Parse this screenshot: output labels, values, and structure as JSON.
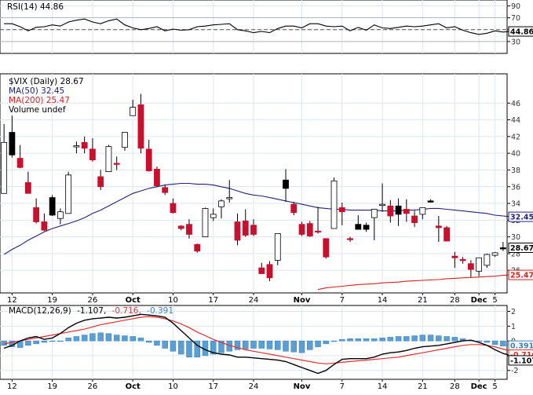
{
  "colors": {
    "up": "#ffffff",
    "down": "#c8102e",
    "doji": "#000000",
    "ma50": "#22227a",
    "ma200": "#d22222",
    "macd_hist": "#5a9fd4",
    "macd_line": "#000000",
    "signal_line": "#e03030",
    "grid": "#dde5f0",
    "axis": "#000000"
  },
  "chart_data": [
    {
      "panel": "rsi",
      "type": "line",
      "legend": "RSI(14) 44.86",
      "ylim": [
        10,
        100
      ],
      "ticks": [
        "90",
        "70",
        "50",
        "30"
      ],
      "last_value_label": "44.86",
      "reference_line": 50,
      "values": [
        60,
        60,
        55,
        48,
        54,
        55,
        58,
        56,
        63,
        66,
        68,
        63,
        60,
        65,
        68,
        58,
        53,
        50,
        52,
        55,
        48,
        51,
        49,
        50,
        55,
        56,
        58,
        59,
        60,
        50,
        48,
        45,
        47,
        45,
        52,
        56,
        56,
        53,
        60,
        60,
        56,
        55,
        56,
        48,
        54,
        49,
        58,
        53,
        52,
        54,
        56,
        55,
        56,
        58,
        60,
        53,
        55,
        49,
        45,
        42,
        44,
        48,
        46,
        47
      ]
    },
    {
      "panel": "price",
      "type": "candlestick",
      "legend": [
        "$VIX (Daily) 28.67",
        "MA(50) 32.45",
        "MA(200) 25.47",
        "Volume undef"
      ],
      "ylim": [
        23.3,
        49.5
      ],
      "ticks": [
        "46",
        "44",
        "42",
        "40",
        "38",
        "36",
        "34",
        "32",
        "30",
        "28",
        "26"
      ],
      "last_value_labels": [
        "32.45",
        "28.67",
        "25.47"
      ],
      "candles": [
        {
          "o": 35.2,
          "h": 43.5,
          "l": 35.2,
          "c": 41.3,
          "k": "up"
        },
        {
          "o": 42.5,
          "h": 44.5,
          "l": 39.5,
          "c": 39.8,
          "k": "doji"
        },
        {
          "o": 39.4,
          "h": 41.0,
          "l": 38.2,
          "c": 38.3,
          "k": "down"
        },
        {
          "o": 36.5,
          "h": 37.8,
          "l": 35.2,
          "c": 35.2,
          "k": "down"
        },
        {
          "o": 33.5,
          "h": 34.6,
          "l": 31.6,
          "c": 31.8,
          "k": "down"
        },
        {
          "o": 31.8,
          "h": 32.8,
          "l": 30.7,
          "c": 30.8,
          "k": "down"
        },
        {
          "o": 34.7,
          "h": 35.0,
          "l": 32.5,
          "c": 32.6,
          "k": "doji"
        },
        {
          "o": 32.2,
          "h": 33.4,
          "l": 31.5,
          "c": 33.0,
          "k": "up"
        },
        {
          "o": 32.8,
          "h": 37.8,
          "l": 32.8,
          "c": 37.4,
          "k": "up"
        },
        {
          "o": 40.9,
          "h": 41.4,
          "l": 40.0,
          "c": 40.8,
          "k": "up"
        },
        {
          "o": 41.3,
          "h": 42.0,
          "l": 40.0,
          "c": 40.6,
          "k": "down"
        },
        {
          "o": 40.5,
          "h": 41.8,
          "l": 39.0,
          "c": 39.2,
          "k": "down"
        },
        {
          "o": 37.2,
          "h": 38.0,
          "l": 35.6,
          "c": 36.0,
          "k": "down"
        },
        {
          "o": 37.8,
          "h": 41.0,
          "l": 37.8,
          "c": 40.8,
          "k": "up"
        },
        {
          "o": 38.8,
          "h": 39.6,
          "l": 38.0,
          "c": 38.7,
          "k": "down"
        },
        {
          "o": 40.7,
          "h": 42.5,
          "l": 40.3,
          "c": 42.5,
          "k": "up"
        },
        {
          "o": 44.5,
          "h": 46.4,
          "l": 44.5,
          "c": 45.5,
          "k": "up"
        },
        {
          "o": 45.8,
          "h": 47.1,
          "l": 40.0,
          "c": 40.6,
          "k": "down"
        },
        {
          "o": 40.5,
          "h": 41.6,
          "l": 37.8,
          "c": 37.9,
          "k": "down"
        },
        {
          "o": 38.1,
          "h": 38.4,
          "l": 36.0,
          "c": 36.1,
          "k": "down"
        },
        {
          "o": 35.9,
          "h": 36.2,
          "l": 35.0,
          "c": 35.3,
          "k": "down"
        },
        {
          "o": 34.0,
          "h": 34.6,
          "l": 32.8,
          "c": 32.9,
          "k": "down"
        },
        {
          "o": 31.3,
          "h": 31.4,
          "l": 30.8,
          "c": 31.0,
          "k": "down"
        },
        {
          "o": 31.5,
          "h": 32.1,
          "l": 29.8,
          "c": 30.3,
          "k": "down"
        },
        {
          "o": 29.1,
          "h": 29.2,
          "l": 28.1,
          "c": 28.3,
          "k": "down"
        },
        {
          "o": 30.0,
          "h": 33.5,
          "l": 30.0,
          "c": 33.4,
          "k": "up"
        },
        {
          "o": 32.3,
          "h": 33.4,
          "l": 31.9,
          "c": 32.7,
          "k": "up"
        },
        {
          "o": 33.6,
          "h": 34.5,
          "l": 32.2,
          "c": 34.3,
          "k": "up"
        },
        {
          "o": 34.6,
          "h": 36.8,
          "l": 34.1,
          "c": 34.7,
          "k": "up"
        },
        {
          "o": 31.8,
          "h": 32.8,
          "l": 29.0,
          "c": 29.6,
          "k": "down"
        },
        {
          "o": 31.9,
          "h": 33.3,
          "l": 30.0,
          "c": 30.2,
          "k": "down"
        },
        {
          "o": 31.4,
          "h": 32.1,
          "l": 30.1,
          "c": 30.3,
          "k": "down"
        },
        {
          "o": 26.3,
          "h": 26.9,
          "l": 26.2,
          "c": 25.6,
          "k": "down"
        },
        {
          "o": 26.7,
          "h": 27.1,
          "l": 24.7,
          "c": 25.1,
          "k": "down"
        },
        {
          "o": 27.2,
          "h": 30.4,
          "l": 26.6,
          "c": 30.4,
          "k": "up"
        },
        {
          "o": 36.8,
          "h": 38.1,
          "l": 34.2,
          "c": 35.8,
          "k": "doji"
        },
        {
          "o": 33.9,
          "h": 34.2,
          "l": 32.6,
          "c": 32.9,
          "k": "down"
        },
        {
          "o": 31.5,
          "h": 31.8,
          "l": 30.1,
          "c": 30.3,
          "k": "down"
        },
        {
          "o": 31.6,
          "h": 31.9,
          "l": 30.0,
          "c": 30.1,
          "k": "down"
        },
        {
          "o": 30.7,
          "h": 33.6,
          "l": 30.4,
          "c": 30.6,
          "k": "down"
        },
        {
          "o": 29.8,
          "h": 29.8,
          "l": 27.4,
          "c": 27.6,
          "k": "down"
        },
        {
          "o": 31.0,
          "h": 37.1,
          "l": 31.0,
          "c": 36.7,
          "k": "up"
        },
        {
          "o": 33.5,
          "h": 34.1,
          "l": 31.4,
          "c": 33.0,
          "k": "down"
        },
        {
          "o": 29.8,
          "h": 30.0,
          "l": 29.4,
          "c": 29.7,
          "k": "down"
        },
        {
          "o": 31.5,
          "h": 32.6,
          "l": 30.9,
          "c": 30.9,
          "k": "doji"
        },
        {
          "o": 30.9,
          "h": 31.7,
          "l": 30.6,
          "c": 31.4,
          "k": "doji"
        },
        {
          "o": 32.3,
          "h": 33.1,
          "l": 29.6,
          "c": 33.3,
          "k": "up"
        },
        {
          "o": 33.9,
          "h": 36.4,
          "l": 33.0,
          "c": 33.8,
          "k": "up"
        },
        {
          "o": 33.7,
          "h": 34.4,
          "l": 31.7,
          "c": 32.5,
          "k": "down"
        },
        {
          "o": 33.7,
          "h": 34.6,
          "l": 31.3,
          "c": 32.7,
          "k": "doji"
        },
        {
          "o": 33.3,
          "h": 34.5,
          "l": 31.8,
          "c": 32.8,
          "k": "down"
        },
        {
          "o": 32.5,
          "h": 33.1,
          "l": 31.2,
          "c": 31.7,
          "k": "down"
        },
        {
          "o": 32.7,
          "h": 33.5,
          "l": 32.1,
          "c": 33.5,
          "k": "up"
        },
        {
          "o": 34.3,
          "h": 34.5,
          "l": 34.1,
          "c": 34.3,
          "k": "doji"
        },
        {
          "o": 31.3,
          "h": 32.5,
          "l": 29.4,
          "c": 31.1,
          "k": "down"
        },
        {
          "o": 31.1,
          "h": 31.3,
          "l": 29.6,
          "c": 29.5,
          "k": "down"
        },
        {
          "o": 27.7,
          "h": 28.2,
          "l": 26.3,
          "c": 27.5,
          "k": "down"
        },
        {
          "o": 27.3,
          "h": 27.6,
          "l": 26.8,
          "c": 27.2,
          "k": "down"
        },
        {
          "o": 26.8,
          "h": 27.2,
          "l": 25.2,
          "c": 26.1,
          "k": "down"
        },
        {
          "o": 25.9,
          "h": 27.5,
          "l": 25.3,
          "c": 27.5,
          "k": "up"
        },
        {
          "o": 26.6,
          "h": 28.0,
          "l": 26.3,
          "c": 27.9,
          "k": "up"
        },
        {
          "o": 27.8,
          "h": 28.2,
          "l": 27.6,
          "c": 28.1,
          "k": "up"
        },
        {
          "o": 28.6,
          "h": 29.4,
          "l": 28.3,
          "c": 28.7,
          "k": "doji"
        }
      ],
      "ma50": [
        27.9,
        28.5,
        29.0,
        29.6,
        30.1,
        30.6,
        31.0,
        31.3,
        31.6,
        31.9,
        32.3,
        32.8,
        33.2,
        33.7,
        34.2,
        34.7,
        35.2,
        35.5,
        35.8,
        36.0,
        36.2,
        36.3,
        36.4,
        36.4,
        36.3,
        36.3,
        36.2,
        36.0,
        35.8,
        35.5,
        35.2,
        35.0,
        34.9,
        34.7,
        34.5,
        34.3,
        34.1,
        33.9,
        33.7,
        33.5,
        33.4,
        33.3,
        33.3,
        33.2,
        33.2,
        33.2,
        33.2,
        33.1,
        33.1,
        33.1,
        33.2,
        33.2,
        33.3,
        33.4,
        33.4,
        33.3,
        33.2,
        33.1,
        33.0,
        32.9,
        32.8,
        32.6,
        32.5,
        32.4
      ],
      "ma200": [
        null,
        null,
        null,
        null,
        null,
        null,
        null,
        null,
        null,
        null,
        null,
        null,
        null,
        null,
        null,
        null,
        null,
        null,
        null,
        null,
        null,
        null,
        null,
        null,
        null,
        null,
        null,
        null,
        null,
        null,
        null,
        null,
        null,
        null,
        null,
        null,
        null,
        null,
        null,
        23.7,
        23.9,
        24.0,
        24.1,
        24.2,
        24.3,
        24.35,
        24.4,
        24.5,
        24.55,
        24.6,
        24.7,
        24.75,
        24.8,
        24.85,
        24.9,
        25.0,
        25.05,
        25.1,
        25.15,
        25.2,
        25.25,
        25.3,
        25.4,
        25.45
      ]
    },
    {
      "panel": "macd",
      "type": "line",
      "legend_parts": [
        "MACD(12,26,9)",
        "-1.107,",
        "-0.716,",
        "-0.391"
      ],
      "ylim": [
        -2.6,
        2.4
      ],
      "ticks": [
        "2",
        "1",
        "0",
        "-1",
        "-2"
      ],
      "last_value_labels": [
        "0.391",
        "-0.716",
        "-1.107"
      ],
      "macd": [
        -0.5,
        -0.3,
        0.0,
        0.2,
        0.3,
        0.1,
        0.2,
        0.5,
        0.9,
        1.2,
        1.4,
        1.5,
        1.55,
        1.6,
        1.55,
        1.6,
        1.7,
        1.8,
        1.75,
        1.7,
        1.6,
        1.2,
        0.7,
        0.2,
        -0.3,
        -0.6,
        -0.8,
        -0.9,
        -0.95,
        -1.1,
        -1.1,
        -1.15,
        -1.2,
        -1.25,
        -1.3,
        -1.4,
        -1.6,
        -1.8,
        -2.0,
        -2.2,
        -2.0,
        -1.6,
        -1.25,
        -1.2,
        -1.2,
        -1.2,
        -1.1,
        -0.9,
        -0.8,
        -0.75,
        -0.65,
        -0.5,
        -0.4,
        -0.35,
        -0.3,
        -0.2,
        -0.1,
        0.0,
        0.05,
        -0.1,
        -0.3,
        -0.6,
        -0.85,
        -1.0
      ],
      "signal": [
        -0.2,
        -0.1,
        0.0,
        0.1,
        0.2,
        0.3,
        0.4,
        0.5,
        0.6,
        0.7,
        0.8,
        0.95,
        1.1,
        1.2,
        1.3,
        1.4,
        1.5,
        1.6,
        1.65,
        1.6,
        1.5,
        1.35,
        1.15,
        0.9,
        0.6,
        0.35,
        0.1,
        -0.1,
        -0.3,
        -0.45,
        -0.6,
        -0.7,
        -0.8,
        -0.9,
        -1.0,
        -1.1,
        -1.2,
        -1.3,
        -1.4,
        -1.5,
        -1.55,
        -1.5,
        -1.45,
        -1.4,
        -1.35,
        -1.3,
        -1.25,
        -1.2,
        -1.15,
        -1.1,
        -1.0,
        -0.9,
        -0.8,
        -0.7,
        -0.6,
        -0.5,
        -0.4,
        -0.3,
        -0.25,
        -0.25,
        -0.3,
        -0.4,
        -0.55,
        -0.7
      ],
      "histogram": [
        -0.3,
        -0.4,
        -0.45,
        -0.3,
        -0.2,
        -0.1,
        0.0,
        0.0,
        0.2,
        0.3,
        0.4,
        0.5,
        0.55,
        0.5,
        0.4,
        0.35,
        0.3,
        0.2,
        -0.1,
        -0.3,
        -0.5,
        -0.7,
        -0.9,
        -1.1,
        -1.1,
        -1.0,
        -0.9,
        -0.8,
        -0.7,
        -0.6,
        -0.55,
        -0.5,
        -0.5,
        -0.55,
        -0.6,
        -0.7,
        -0.75,
        -0.8,
        -0.6,
        -0.4,
        -0.2,
        0.0,
        0.1,
        0.15,
        0.15,
        0.15,
        0.15,
        0.2,
        0.25,
        0.3,
        0.3,
        0.35,
        0.4,
        0.4,
        0.35,
        0.3,
        0.25,
        0.15,
        0.05,
        -0.05,
        -0.1,
        -0.25,
        -0.35,
        -0.4
      ]
    }
  ],
  "x_axis": {
    "labels": [
      {
        "text": "12",
        "i": 1,
        "bold": false
      },
      {
        "text": "19",
        "i": 6,
        "bold": false
      },
      {
        "text": "26",
        "i": 11,
        "bold": false
      },
      {
        "text": "Oct",
        "i": 16,
        "bold": true
      },
      {
        "text": "10",
        "i": 21,
        "bold": false
      },
      {
        "text": "17",
        "i": 26,
        "bold": false
      },
      {
        "text": "24",
        "i": 31,
        "bold": false
      },
      {
        "text": "Nov",
        "i": 37,
        "bold": true
      },
      {
        "text": "7",
        "i": 42,
        "bold": false
      },
      {
        "text": "14",
        "i": 47,
        "bold": false
      },
      {
        "text": "21",
        "i": 52,
        "bold": false
      },
      {
        "text": "28",
        "i": 56,
        "bold": false
      },
      {
        "text": "Dec",
        "i": 59,
        "bold": true
      },
      {
        "text": "5",
        "i": 61,
        "bold": false
      }
    ]
  }
}
